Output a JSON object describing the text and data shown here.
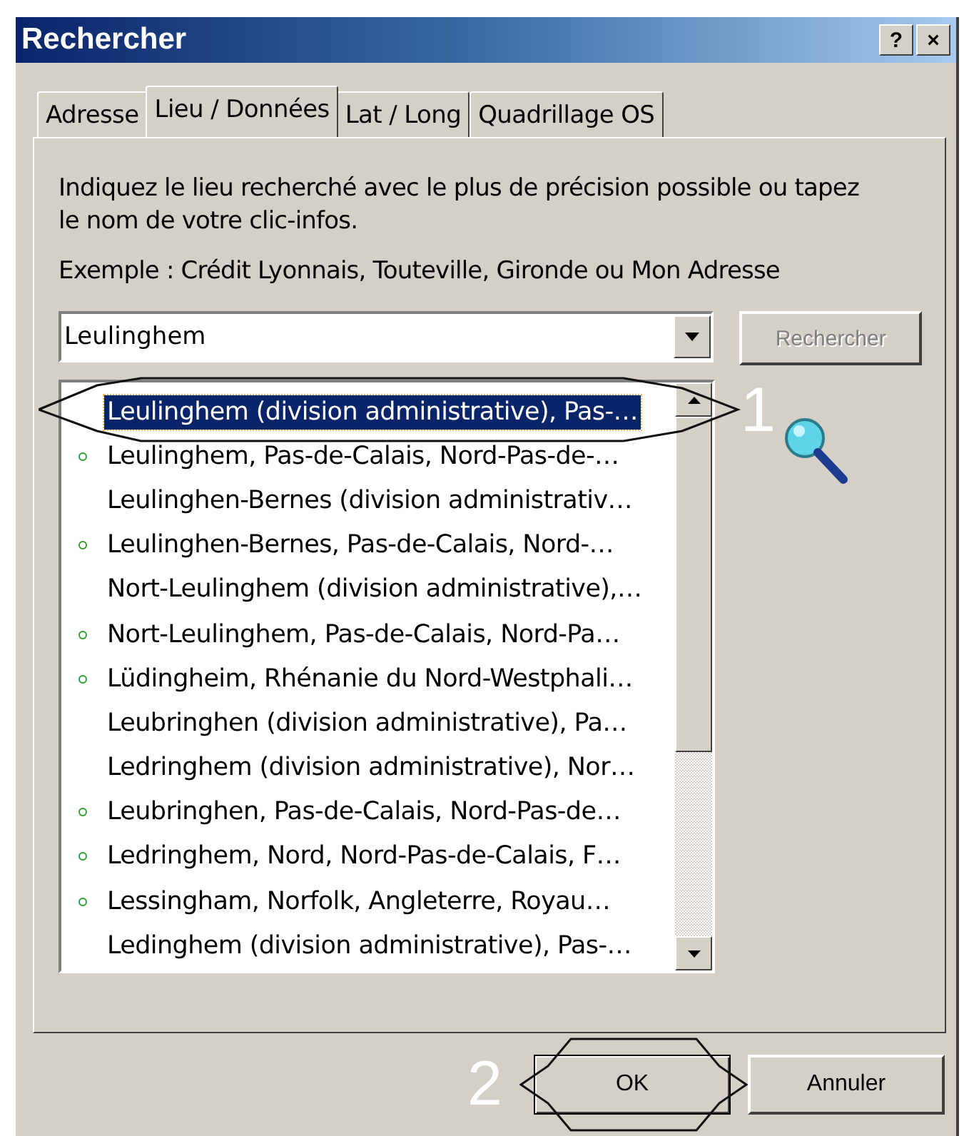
{
  "window": {
    "title": "Rechercher",
    "help_button": "?",
    "close_button": "×"
  },
  "tabs": [
    {
      "label": "Adresse",
      "selected": false
    },
    {
      "label": "Lieu / Données",
      "selected": true
    },
    {
      "label": "Lat / Long",
      "selected": false
    },
    {
      "label": "Quadrillage OS",
      "selected": false
    }
  ],
  "instructions": "Indiquez le lieu recherché avec le plus de précision possible ou tapez le nom de votre clic-infos.",
  "example": "Exemple : Crédit Lyonnais, Touteville, Gironde ou Mon  Adresse",
  "search": {
    "value": "Leulinghem",
    "button": {
      "label": "Rechercher",
      "disabled": true
    }
  },
  "results": [
    {
      "text": "Leulinghem (division administrative), Pas-…",
      "dot": false,
      "selected": true
    },
    {
      "text": "Leulinghem, Pas-de-Calais, Nord-Pas-de-…",
      "dot": true,
      "selected": false
    },
    {
      "text": "Leulinghen-Bernes (division administrativ…",
      "dot": false,
      "selected": false
    },
    {
      "text": "Leulinghen-Bernes, Pas-de-Calais, Nord-…",
      "dot": true,
      "selected": false
    },
    {
      "text": "Nort-Leulinghem (division administrative),…",
      "dot": false,
      "selected": false
    },
    {
      "text": "Nort-Leulinghem, Pas-de-Calais, Nord-Pa…",
      "dot": true,
      "selected": false
    },
    {
      "text": "Lüdingheim, Rhénanie du Nord-Westphali…",
      "dot": true,
      "selected": false
    },
    {
      "text": "Leubringhen (division administrative), Pa…",
      "dot": false,
      "selected": false
    },
    {
      "text": "Ledringhem (division administrative), Nor…",
      "dot": false,
      "selected": false
    },
    {
      "text": "Leubringhen, Pas-de-Calais, Nord-Pas-de…",
      "dot": true,
      "selected": false
    },
    {
      "text": "Ledringhem, Nord, Nord-Pas-de-Calais, F…",
      "dot": true,
      "selected": false
    },
    {
      "text": "Lessingham, Norfolk, Angleterre, Royau…",
      "dot": true,
      "selected": false
    },
    {
      "text": "Ledinghem (division administrative), Pas-…",
      "dot": false,
      "selected": false
    }
  ],
  "annotations": [
    "1",
    "2"
  ],
  "buttons": [
    {
      "label": "OK",
      "default": true
    },
    {
      "label": "Annuler",
      "default": false
    }
  ]
}
